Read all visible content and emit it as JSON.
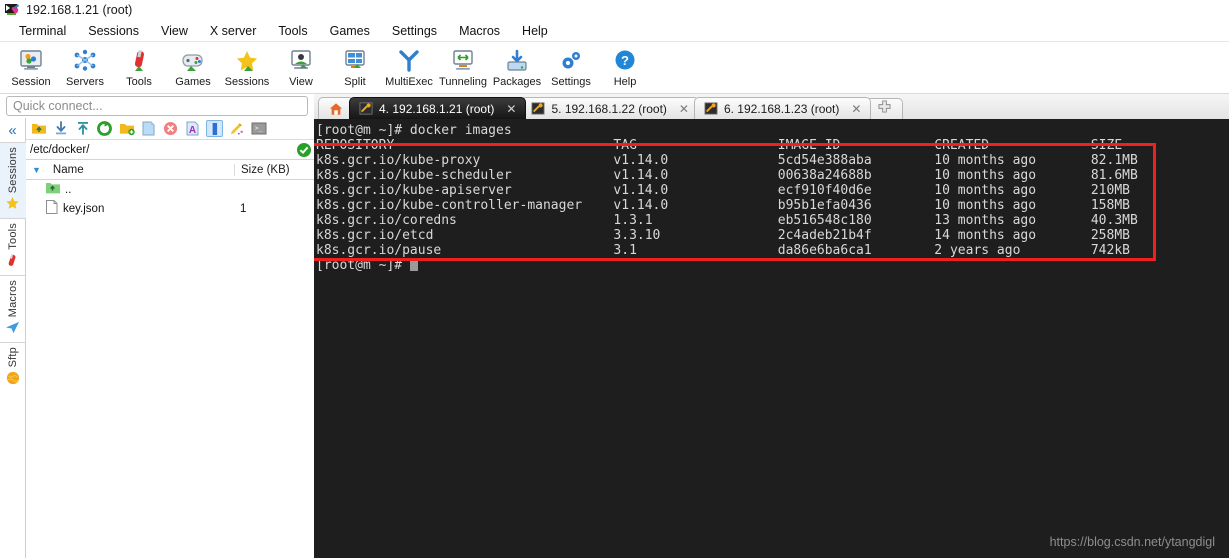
{
  "window": {
    "title": "192.168.1.21 (root)",
    "icon": "mobaxterm-app-icon"
  },
  "menubar": {
    "items": [
      {
        "label": "Terminal"
      },
      {
        "label": "Sessions"
      },
      {
        "label": "View"
      },
      {
        "label": "X server"
      },
      {
        "label": "Tools"
      },
      {
        "label": "Games"
      },
      {
        "label": "Settings"
      },
      {
        "label": "Macros"
      },
      {
        "label": "Help"
      }
    ]
  },
  "toolbar": {
    "buttons": [
      {
        "label": "Session",
        "icon": "session-icon"
      },
      {
        "label": "Servers",
        "icon": "servers-icon"
      },
      {
        "label": "Tools",
        "icon": "tools-icon"
      },
      {
        "label": "Games",
        "icon": "games-icon"
      },
      {
        "label": "Sessions",
        "icon": "sessions-star-icon"
      },
      {
        "label": "View",
        "icon": "view-icon"
      },
      {
        "label": "Split",
        "icon": "split-icon"
      },
      {
        "label": "MultiExec",
        "icon": "multiexec-icon"
      },
      {
        "label": "Tunneling",
        "icon": "tunneling-icon"
      },
      {
        "label": "Packages",
        "icon": "packages-icon"
      },
      {
        "label": "Settings",
        "icon": "settings-gear-icon"
      },
      {
        "label": "Help",
        "icon": "help-icon"
      }
    ]
  },
  "sidebar": {
    "quick_connect_placeholder": "Quick connect...",
    "collapse_icon": "double-chevron-left-icon",
    "rail": [
      {
        "label": "Sessions",
        "icon": "star-icon",
        "active": true
      },
      {
        "label": "Tools",
        "icon": "swiss-knife-icon",
        "active": false
      },
      {
        "label": "Macros",
        "icon": "paper-plane-icon",
        "active": false
      },
      {
        "label": "Sftp",
        "icon": "globe-icon",
        "active": false
      }
    ],
    "sftp": {
      "toolbar_icons": [
        "parent-folder-icon",
        "download-icon",
        "upload-icon",
        "refresh-icon",
        "new-folder-icon",
        "new-file-icon",
        "delete-icon",
        "text-edit-icon",
        "follow-terminal-folder-icon",
        "permissions-icon",
        "open-terminal-icon"
      ],
      "path": "/etc/docker/",
      "path_status_icon": "green-check-icon",
      "columns": [
        "Name",
        "Size (KB)"
      ],
      "sort_caret_icon": "caret-down-icon",
      "rows": [
        {
          "name": "..",
          "size": "",
          "icon": "parent-folder-icon"
        },
        {
          "name": "key.json",
          "size": "1",
          "icon": "file-icon"
        }
      ]
    }
  },
  "tabs": {
    "home_icon": "home-icon",
    "items": [
      {
        "label": "4. 192.168.1.21 (root)",
        "icon": "ssh-key-icon",
        "active": true,
        "close_icon": "close-icon"
      },
      {
        "label": "5. 192.168.1.22 (root)",
        "icon": "ssh-key-icon",
        "active": false,
        "close_icon": "close-icon"
      },
      {
        "label": "6. 192.168.1.23 (root)",
        "icon": "ssh-key-icon",
        "active": false,
        "close_icon": "close-icon"
      }
    ],
    "add_tab_icon": "plus-tab-icon"
  },
  "terminal": {
    "prompt_command": "[root@m ~]# docker images",
    "header": {
      "repository": "REPOSITORY",
      "tag": "TAG",
      "image_id": "IMAGE ID",
      "created": "CREATED",
      "size": "SIZE"
    },
    "images": [
      {
        "repository": "k8s.gcr.io/kube-proxy",
        "tag": "v1.14.0",
        "image_id": "5cd54e388aba",
        "created": "10 months ago",
        "size": "82.1MB"
      },
      {
        "repository": "k8s.gcr.io/kube-scheduler",
        "tag": "v1.14.0",
        "image_id": "00638a24688b",
        "created": "10 months ago",
        "size": "81.6MB"
      },
      {
        "repository": "k8s.gcr.io/kube-apiserver",
        "tag": "v1.14.0",
        "image_id": "ecf910f40d6e",
        "created": "10 months ago",
        "size": "210MB"
      },
      {
        "repository": "k8s.gcr.io/kube-controller-manager",
        "tag": "v1.14.0",
        "image_id": "b95b1efa0436",
        "created": "10 months ago",
        "size": "158MB"
      },
      {
        "repository": "k8s.gcr.io/coredns",
        "tag": "1.3.1",
        "image_id": "eb516548c180",
        "created": "13 months ago",
        "size": "40.3MB"
      },
      {
        "repository": "k8s.gcr.io/etcd",
        "tag": "3.3.10",
        "image_id": "2c4adeb21b4f",
        "created": "14 months ago",
        "size": "258MB"
      },
      {
        "repository": "k8s.gcr.io/pause",
        "tag": "3.1",
        "image_id": "da86e6ba6ca1",
        "created": "2 years ago",
        "size": "742kB"
      }
    ],
    "trailing_prompt": "[root@m ~]#",
    "highlight_color": "#f02020"
  },
  "watermark": {
    "text": "https://blog.csdn.net/ytangdigl"
  }
}
